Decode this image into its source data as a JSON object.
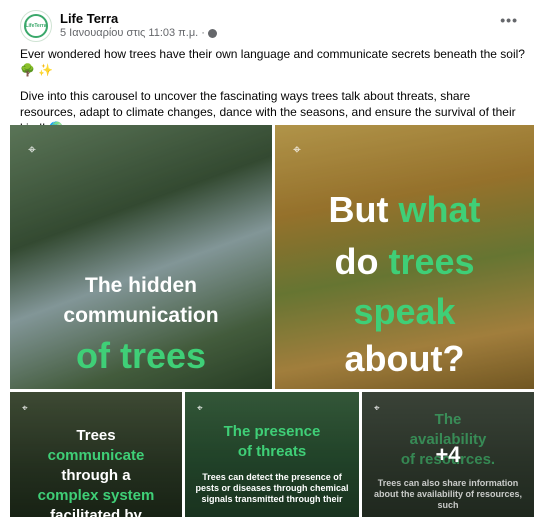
{
  "author": {
    "name": "Life Terra",
    "avatar_text": "LifeTerra"
  },
  "post": {
    "time": "5 Ιανουαρίου στις 11:03 π.μ. ·",
    "paragraph1": "Ever wondered how trees have their own language and communicate secrets beneath the soil? 🌳 ✨",
    "paragraph2": "Dive into this carousel to uncover the fascinating ways trees talk about threats, share resources, adapt to climate changes, dance with the seasons, and ensure the survival of their kind! 🌍",
    "more_label": "•••"
  },
  "gallery": {
    "tile1": {
      "line1": "The hidden",
      "line2": "communication",
      "line3": "of trees"
    },
    "tile2": {
      "line1": "But",
      "line1b": "what",
      "line2a": "do",
      "line2b": "trees",
      "line3": "speak",
      "line4": "about?"
    },
    "tile3": {
      "line1": "Trees",
      "line2": "communicate",
      "line3": "through a",
      "line4": "complex system",
      "line5": "facilitated by"
    },
    "tile4": {
      "line1": "The presence",
      "line2": "of threats",
      "body": "Trees can detect the presence of pests or diseases through chemical signals transmitted through their"
    },
    "tile5": {
      "line1": "The",
      "line2": "availability",
      "line3": "of resources.",
      "body": "Trees can also share information about the availability of resources, such",
      "more_count": "+4"
    }
  },
  "colors": {
    "accent_green": "#3fcf77",
    "text_secondary": "#65676b"
  },
  "icons": {
    "pin": "location-leaf-icon",
    "globe": "globe-icon",
    "more": "more-options-icon"
  }
}
